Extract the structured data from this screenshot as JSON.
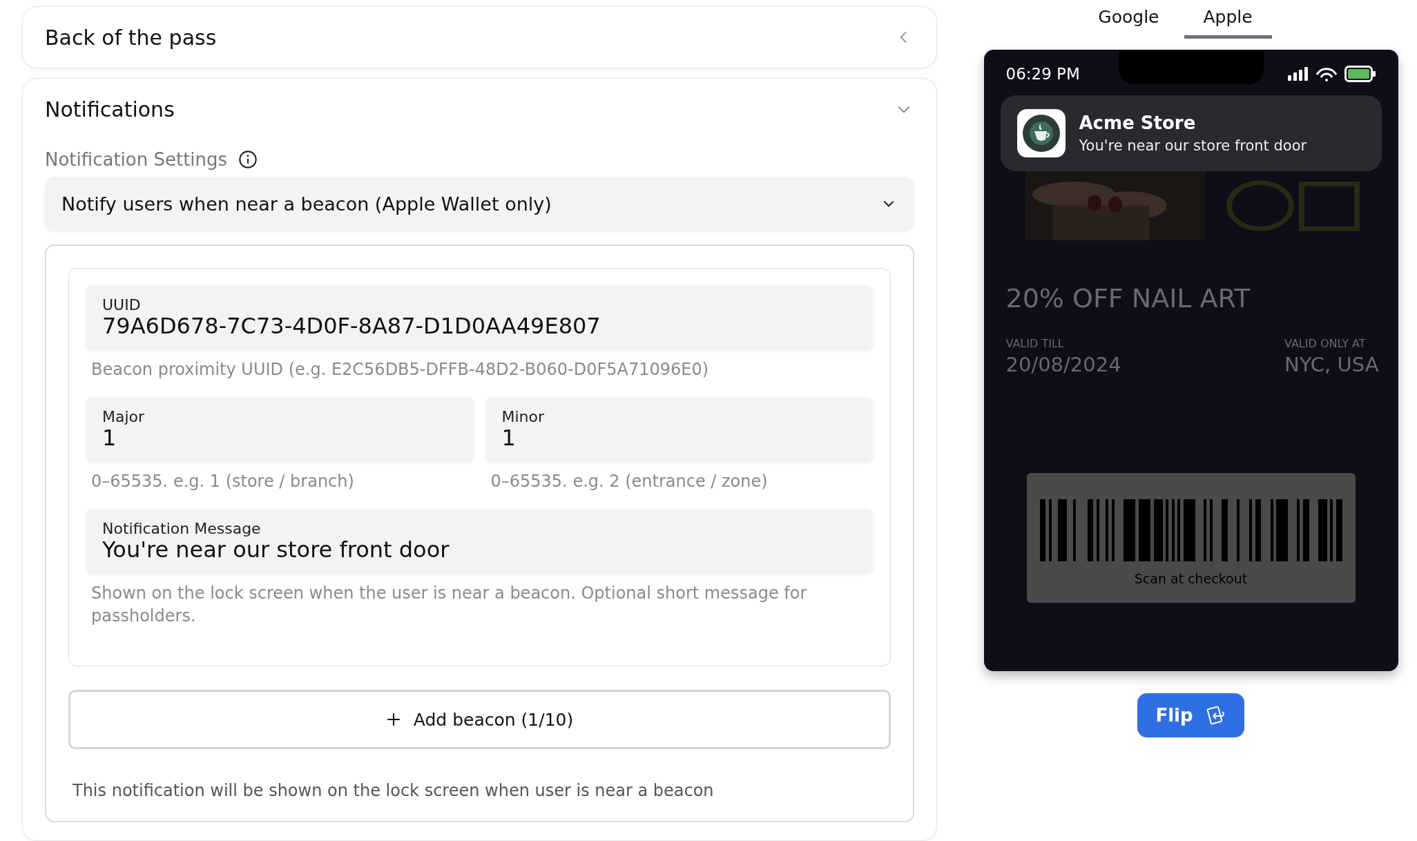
{
  "sections": [
    {
      "title": "Back of the pass",
      "expanded": false
    },
    {
      "title": "Notifications",
      "expanded": true
    }
  ],
  "notification_settings": {
    "label": "Notification Settings",
    "select": {
      "value": "Notify users when near a beacon (Apple Wallet only)"
    }
  },
  "beacons": [
    {
      "uuid": {
        "label": "UUID",
        "value": "79A6D678-7C73-4D0F-8A87-D1D0AA49E807",
        "hint": "Beacon proximity UUID (e.g. E2C56DB5-DFFB-48D2-B060-D0F5A71096E0)"
      },
      "major": {
        "label": "Major",
        "value": "1",
        "hint": "0–65535. e.g. 1 (store / branch)"
      },
      "minor": {
        "label": "Minor",
        "value": "1",
        "hint": "0–65535. e.g. 2 (entrance / zone)"
      },
      "message": {
        "label": "Notification Message",
        "value": "You're near our store front door",
        "hint": "Shown on the lock screen when the user is near a beacon. Optional short message for passholders."
      }
    }
  ],
  "add_button": "Add beacon (1/10)",
  "footer_note": "This notification will be shown on the lock screen when user is near a beacon",
  "preview_tabs": [
    {
      "label": "Google",
      "selected": false
    },
    {
      "label": "Apple",
      "selected": true
    }
  ],
  "phone": {
    "time": "06:29 PM",
    "notification": {
      "app": "Acme Store",
      "message": "You're near our store front door"
    },
    "pass": {
      "headline": "20% OFF NAIL ART",
      "fields": [
        {
          "label": "VALID TILL",
          "value": "20/08/2024"
        },
        {
          "label": "VALID ONLY AT",
          "value": "NYC, USA"
        }
      ],
      "barcode_caption": "Scan at checkout"
    }
  },
  "flip_button": "Flip"
}
